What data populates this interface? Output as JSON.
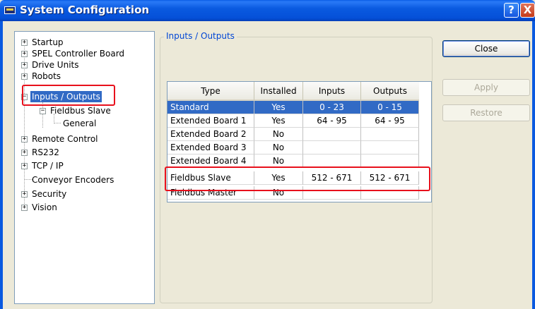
{
  "window": {
    "title": "System Configuration",
    "help_glyph": "?",
    "close_glyph": "X"
  },
  "tree": {
    "items": [
      {
        "label": "Startup",
        "expander": "+"
      },
      {
        "label": "SPEL Controller Board",
        "expander": "+"
      },
      {
        "label": "Drive Units",
        "expander": "+"
      },
      {
        "label": "Robots",
        "expander": "+"
      },
      {
        "label": "Inputs / Outputs",
        "expander": "−",
        "selected": true
      },
      {
        "label": "Fieldbus Slave",
        "expander": "−"
      },
      {
        "label": "General"
      },
      {
        "label": "Remote Control",
        "expander": "+"
      },
      {
        "label": "RS232",
        "expander": "+"
      },
      {
        "label": "TCP / IP",
        "expander": "+"
      },
      {
        "label": "Conveyor Encoders"
      },
      {
        "label": "Security",
        "expander": "+"
      },
      {
        "label": "Vision",
        "expander": "+"
      }
    ]
  },
  "group": {
    "title": "Inputs / Outputs"
  },
  "grid": {
    "columns": [
      "Type",
      "Installed",
      "Inputs",
      "Outputs"
    ],
    "rows": [
      {
        "type": "Standard",
        "installed": "Yes",
        "inputs": "0 - 23",
        "outputs": "0 - 15",
        "selected": true
      },
      {
        "type": "Extended Board 1",
        "installed": "Yes",
        "inputs": "64 - 95",
        "outputs": "64 - 95"
      },
      {
        "type": "Extended Board 2",
        "installed": "No",
        "inputs": "",
        "outputs": ""
      },
      {
        "type": "Extended Board 3",
        "installed": "No",
        "inputs": "",
        "outputs": ""
      },
      {
        "type": "Extended Board 4",
        "installed": "No",
        "inputs": "",
        "outputs": ""
      },
      {
        "type": "Fieldbus Slave",
        "installed": "Yes",
        "inputs": "512 - 671",
        "outputs": "512 - 671"
      },
      {
        "type": "Fieldbus Master",
        "installed": "No",
        "inputs": "",
        "outputs": ""
      }
    ]
  },
  "buttons": {
    "close": "Close",
    "apply": "Apply",
    "restore": "Restore"
  },
  "colors": {
    "titlebar": "#0a5ae0",
    "selection": "#316ac5",
    "highlight": "#e8101c",
    "group_title": "#0046d5"
  }
}
